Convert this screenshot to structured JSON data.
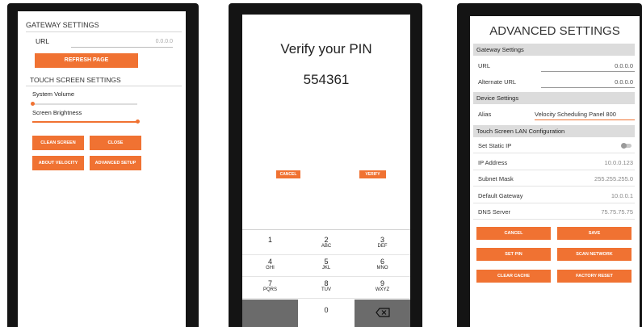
{
  "panel1": {
    "title": "GATEWAY SETTINGS",
    "url_label": "URL",
    "url_value": "0.0.0.0",
    "refresh_label": "REFRESH PAGE",
    "touch_title": "TOUCH SCREEN SETTINGS",
    "volume_label": "System Volume",
    "volume_level": 0.0,
    "brightness_label": "Screen Brightness",
    "brightness_level": 1.0,
    "buttons": {
      "clean_screen": "CLEAN SCREEN",
      "close": "CLOSE",
      "about": "ABOUT VELOCITY",
      "advanced": "ADVANCED SETUP"
    }
  },
  "panel2": {
    "title": "Verify your PIN",
    "pin": "554361",
    "cancel_label": "CANCEL",
    "verify_label": "VERIFY",
    "keys": [
      {
        "num": "1",
        "letters": ""
      },
      {
        "num": "2",
        "letters": "ABC"
      },
      {
        "num": "3",
        "letters": "DEF"
      },
      {
        "num": "4",
        "letters": "GHI"
      },
      {
        "num": "5",
        "letters": "JKL"
      },
      {
        "num": "6",
        "letters": "MNO"
      },
      {
        "num": "7",
        "letters": "PQRS"
      },
      {
        "num": "8",
        "letters": "TUV"
      },
      {
        "num": "9",
        "letters": "WXYZ"
      },
      {
        "num": "0",
        "letters": ""
      }
    ],
    "backspace_icon": "backspace-icon"
  },
  "panel3": {
    "title": "ADVANCED SETTINGS",
    "gateway_section": "Gateway Settings",
    "url_label": "URL",
    "url_value": "0.0.0.0",
    "alt_url_label": "Alternate URL",
    "alt_url_value": "0.0.0.0",
    "device_section": "Device Settings",
    "alias_label": "Alias",
    "alias_value": "Velocity Scheduling Panel 800",
    "lan_section": "Touch Screen LAN Configuration",
    "static_ip_label": "Set Static IP",
    "static_ip_on": false,
    "ip_label": "IP Address",
    "ip_value": "10.0.0.123",
    "subnet_label": "Subnet Mask",
    "subnet_value": "255.255.255.0",
    "gateway_label": "Default Gateway",
    "gateway_value": "10.0.0.1",
    "dns_label": "DNS Server",
    "dns_value": "75.75.75.75",
    "buttons": {
      "cancel": "CANCEL",
      "save": "SAVE",
      "set_pin": "SET PIN",
      "scan_network": "SCAN NETWORK",
      "clear_cache": "CLEAR CACHE",
      "factory_reset": "FACTORY RESET"
    }
  },
  "colors": {
    "accent": "#f07232",
    "bezel": "#141414",
    "section_bg": "#dcdcdc",
    "keypad_dark": "#6b6b6b"
  }
}
